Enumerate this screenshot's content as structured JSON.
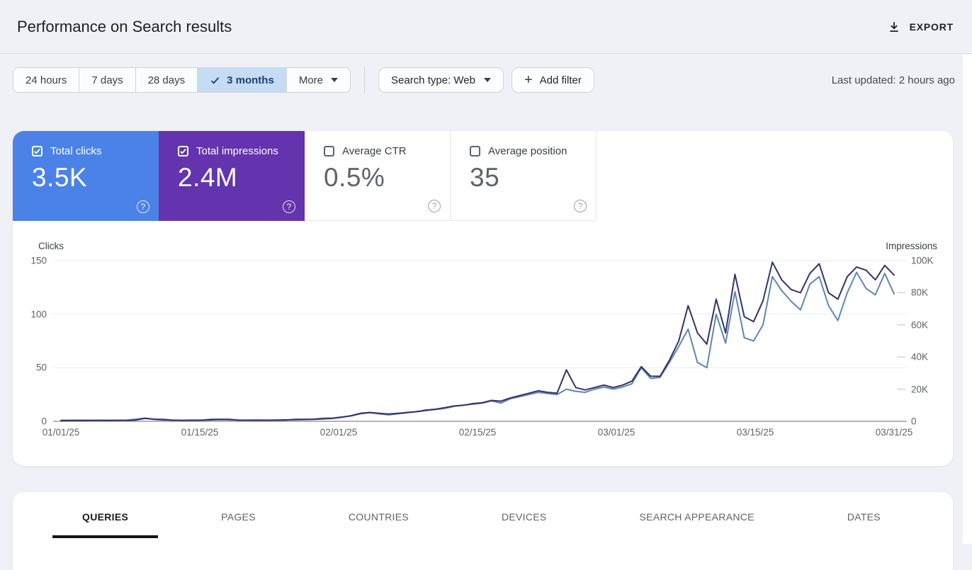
{
  "header": {
    "title": "Performance on Search results",
    "export_label": "EXPORT"
  },
  "filterbar": {
    "ranges": [
      {
        "label": "24 hours",
        "selected": false
      },
      {
        "label": "7 days",
        "selected": false
      },
      {
        "label": "28 days",
        "selected": false
      },
      {
        "label": "3 months",
        "selected": true
      },
      {
        "label": "More",
        "selected": false,
        "dropdown": true
      }
    ],
    "search_type_label": "Search type: Web",
    "add_filter_label": "Add filter",
    "last_updated": "Last updated: 2 hours ago"
  },
  "cards": [
    {
      "label": "Total clicks",
      "value": "3.5K",
      "checked": true,
      "color": "#4a82e8"
    },
    {
      "label": "Total impressions",
      "value": "2.4M",
      "checked": true,
      "color": "#6334ad"
    },
    {
      "label": "Average CTR",
      "value": "0.5%",
      "checked": false
    },
    {
      "label": "Average position",
      "value": "35",
      "checked": false
    }
  ],
  "icons": {
    "export": "download-icon",
    "range_selected": "check-icon",
    "dropdown": "caret-down-icon",
    "add_filter": "plus-icon",
    "card_checked": "checkbox-checked-icon",
    "card_unchecked": "checkbox-unchecked-icon",
    "help": "question-mark-circle-icon"
  },
  "chart_data": {
    "type": "line",
    "grid": "horizontal-only",
    "left_axis": {
      "label": "Clicks",
      "ticks": [
        0,
        50,
        100,
        150
      ],
      "max": 150
    },
    "right_axis": {
      "label": "Impressions",
      "ticks": [
        "0",
        "20K",
        "40K",
        "60K",
        "80K",
        "100K"
      ],
      "tick_values": [
        0,
        20000,
        40000,
        60000,
        80000,
        100000
      ],
      "max": 100000
    },
    "x_tick_labels": [
      "01/01/25",
      "01/15/25",
      "02/01/25",
      "02/15/25",
      "03/01/25",
      "03/15/25",
      "03/31/25"
    ],
    "x_range": [
      "01/01/25",
      "03/31/25"
    ],
    "series": [
      {
        "name": "Clicks",
        "axis": "left",
        "color": "#5d87b3",
        "values": [
          1,
          1,
          1,
          1,
          1,
          1,
          1,
          1,
          2,
          3,
          2,
          2,
          1,
          1,
          1,
          1,
          2,
          2,
          2,
          1,
          1,
          1,
          1,
          1,
          1,
          2,
          2,
          2,
          3,
          3,
          4,
          5,
          7,
          8,
          7,
          6,
          7,
          8,
          9,
          10,
          11,
          12,
          14,
          15,
          16,
          17,
          19,
          17,
          21,
          23,
          25,
          27,
          26,
          25,
          30,
          28,
          27,
          30,
          32,
          30,
          32,
          35,
          50,
          40,
          41,
          55,
          70,
          86,
          55,
          50,
          100,
          73,
          121,
          78,
          75,
          90,
          135,
          122,
          112,
          104,
          128,
          135,
          108,
          94,
          120,
          139,
          124,
          118,
          138,
          119
        ]
      },
      {
        "name": "Impressions",
        "axis": "right",
        "color": "#34326a",
        "values": [
          400,
          500,
          500,
          500,
          600,
          500,
          600,
          600,
          800,
          1800,
          1200,
          900,
          700,
          600,
          700,
          700,
          900,
          1100,
          1000,
          800,
          700,
          800,
          700,
          800,
          900,
          1000,
          1100,
          1200,
          1500,
          1800,
          2500,
          3500,
          5000,
          5500,
          5000,
          4500,
          5000,
          5500,
          6000,
          7000,
          7500,
          8500,
          9500,
          10000,
          11000,
          11500,
          13000,
          12500,
          14500,
          16000,
          17500,
          19000,
          18000,
          17500,
          32000,
          21000,
          19500,
          21000,
          22500,
          21000,
          22500,
          25000,
          34000,
          28000,
          28000,
          38000,
          50000,
          72000,
          55000,
          48000,
          76000,
          55000,
          91500,
          65000,
          62000,
          75000,
          99000,
          88000,
          82000,
          80000,
          92000,
          98000,
          80000,
          76000,
          90000,
          96000,
          94000,
          88000,
          97000,
          91000
        ]
      }
    ]
  },
  "tabs": [
    {
      "label": "QUERIES",
      "active": true
    },
    {
      "label": "PAGES",
      "active": false
    },
    {
      "label": "COUNTRIES",
      "active": false
    },
    {
      "label": "DEVICES",
      "active": false
    },
    {
      "label": "SEARCH APPEARANCE",
      "active": false
    },
    {
      "label": "DATES",
      "active": false
    }
  ]
}
